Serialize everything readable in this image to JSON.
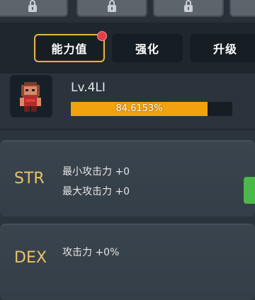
{
  "top_slots": [
    {
      "icon": "lock-icon"
    },
    {
      "icon": "lock-icon"
    },
    {
      "icon": "lock-icon"
    }
  ],
  "tabs": [
    {
      "label": "能力值",
      "active": true,
      "badge": true
    },
    {
      "label": "强化",
      "active": false
    },
    {
      "label": "升级",
      "active": false
    }
  ],
  "character": {
    "level_text": "Lv.4LI",
    "progress_percent": 84.6153,
    "progress_text": "84.6153%"
  },
  "stats": [
    {
      "name": "STR",
      "lines": [
        "最小攻击力 +0",
        "最大攻击力 +0"
      ]
    },
    {
      "name": "DEX",
      "lines": [
        "攻击力 +0%"
      ]
    }
  ],
  "colors": {
    "accent_gold": "#e0b54a",
    "progress_fill": "#f2a10f",
    "stat_name": "#e8c46a",
    "badge_red": "#e0404a",
    "side_button_green": "#4cb84a"
  }
}
